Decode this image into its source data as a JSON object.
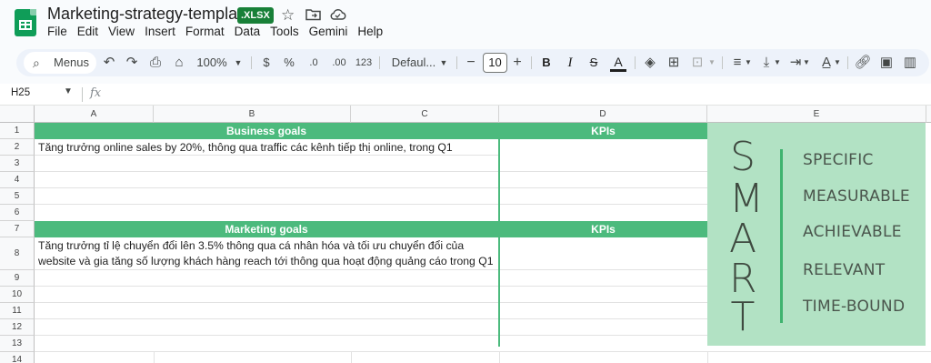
{
  "titlebar": {
    "doc_title": "Marketing-strategy-template",
    "file_badge": ".XLSX",
    "star_icon": "☆",
    "move_icon": "⤷",
    "cloud_icon": "☁"
  },
  "menu": [
    "File",
    "Edit",
    "View",
    "Insert",
    "Format",
    "Data",
    "Tools",
    "Gemini",
    "Help"
  ],
  "toolbar": {
    "search_label": "Menus",
    "zoom": "100%",
    "currency": "$",
    "percent": "%",
    "dec_decrease": ".0",
    "dec_increase": ".00",
    "number_format": "123",
    "font": "Defaul...",
    "font_size": "10",
    "minus": "−",
    "plus": "+",
    "bold": "B",
    "italic": "I",
    "strike": "S",
    "text_color": "A"
  },
  "formula_bar": {
    "name_box": "H25",
    "fx": "fx",
    "value": ""
  },
  "columns": [
    "A",
    "B",
    "C",
    "D",
    "E"
  ],
  "rows": [
    "1",
    "2",
    "3",
    "4",
    "5",
    "6",
    "7",
    "8",
    "9",
    "10",
    "11",
    "12",
    "13",
    "14"
  ],
  "cells": {
    "business_goals": "Business goals",
    "kpis_1": "KPIs",
    "row2_text": "Tăng trưởng online sales by 20%, thông qua traffic các kênh tiếp thị online, trong Q1",
    "marketing_goals": "Marketing goals",
    "kpis_2": "KPIs",
    "row8_line1": "Tăng trưởng tỉ lệ chuyển đổi lên 3.5% thông qua cá nhân hóa và tối ưu chuyển đổi của",
    "row8_line2": "website và gia tăng số lượng khách hàng reach tới thông qua hoạt động quảng cáo trong Q1"
  },
  "smart": {
    "letters": [
      "S",
      "M",
      "A",
      "R",
      "T"
    ],
    "words": [
      "SPECIFIC",
      "MEASURABLE",
      "ACHIEVABLE",
      "RELEVANT",
      "TIME-BOUND"
    ]
  },
  "colors": {
    "header_green": "#4cba7d",
    "smart_bg": "#b2e2c4",
    "smart_bar": "#3fb36f",
    "badge_green": "#188038"
  }
}
